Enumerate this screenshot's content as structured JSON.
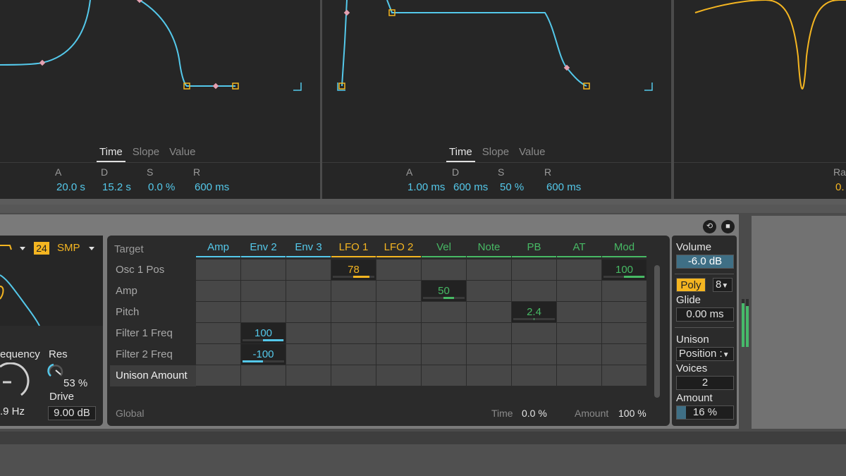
{
  "envelopes": [
    {
      "tabs": [
        "Time",
        "Slope",
        "Value"
      ],
      "params": [
        {
          "label": "A",
          "value": "20.0 s"
        },
        {
          "label": "D",
          "value": "15.2 s"
        },
        {
          "label": "S",
          "value": "0.0 %"
        },
        {
          "label": "R",
          "value": "600 ms"
        }
      ]
    },
    {
      "tabs": [
        "Time",
        "Slope",
        "Value"
      ],
      "params": [
        {
          "label": "A",
          "value": "1.00 ms"
        },
        {
          "label": "D",
          "value": "600 ms"
        },
        {
          "label": "S",
          "value": "50 %"
        },
        {
          "label": "R",
          "value": "600 ms"
        }
      ]
    }
  ],
  "lfo_partial": {
    "label": "Ra",
    "value": "0."
  },
  "filter": {
    "slope_value": "24",
    "type_label": "SMP",
    "frequency_label": "equency",
    "frequency_value": ".9 Hz",
    "res_label": "Res",
    "res_value": "53 %",
    "drive_label": "Drive",
    "drive_value": "9.00 dB"
  },
  "matrix": {
    "target_label": "Target",
    "columns": [
      {
        "label": "Amp",
        "color": "#54c8ea"
      },
      {
        "label": "Env 2",
        "color": "#54c8ea"
      },
      {
        "label": "Env 3",
        "color": "#54c8ea"
      },
      {
        "label": "LFO 1",
        "color": "#f4b521"
      },
      {
        "label": "LFO 2",
        "color": "#f4b521"
      },
      {
        "label": "Vel",
        "color": "#47b964"
      },
      {
        "label": "Note",
        "color": "#47b964"
      },
      {
        "label": "PB",
        "color": "#47b964"
      },
      {
        "label": "AT",
        "color": "#47b964"
      },
      {
        "label": "Mod",
        "color": "#47b964"
      }
    ],
    "rows": [
      "Osc 1 Pos",
      "Amp",
      "Pitch",
      "Filter 1 Freq",
      "Filter 2 Freq",
      "Unison Amount"
    ],
    "selected_row": 5,
    "cells": [
      {
        "row": 0,
        "col": 3,
        "value": "78",
        "amount": 0.78,
        "color": "#f4b521"
      },
      {
        "row": 0,
        "col": 9,
        "value": "100",
        "amount": 1.0,
        "color": "#47b964"
      },
      {
        "row": 1,
        "col": 5,
        "value": "50",
        "amount": 0.5,
        "color": "#47b964"
      },
      {
        "row": 2,
        "col": 7,
        "value": "2.4",
        "amount": 0.024,
        "color": "#47b964"
      },
      {
        "row": 3,
        "col": 1,
        "value": "100",
        "amount": 1.0,
        "color": "#54c8ea"
      },
      {
        "row": 4,
        "col": 1,
        "value": "-100",
        "amount": -1.0,
        "color": "#54c8ea"
      }
    ],
    "global_label": "Global",
    "time_label": "Time",
    "time_value": "0.0 %",
    "amount_label": "Amount",
    "amount_value": "100 %"
  },
  "voice": {
    "volume_label": "Volume",
    "volume_value": "-6.0 dB",
    "poly_label": "Poly",
    "voices_count": "8",
    "glide_label": "Glide",
    "glide_value": "0.00 ms",
    "unison_label": "Unison",
    "unison_mode": "Position :",
    "voices_label": "Voices",
    "voices_value": "2",
    "amount_label": "Amount",
    "amount_value": "16 %",
    "amount_fraction": 0.16
  },
  "icons": [
    "hot-swap-icon",
    "save-preset-icon",
    "dropdown-arrow-icon",
    "filter-curve-icon"
  ],
  "colors": {
    "blue": "#54c8ea",
    "orange": "#f4b521",
    "green": "#47b964"
  }
}
